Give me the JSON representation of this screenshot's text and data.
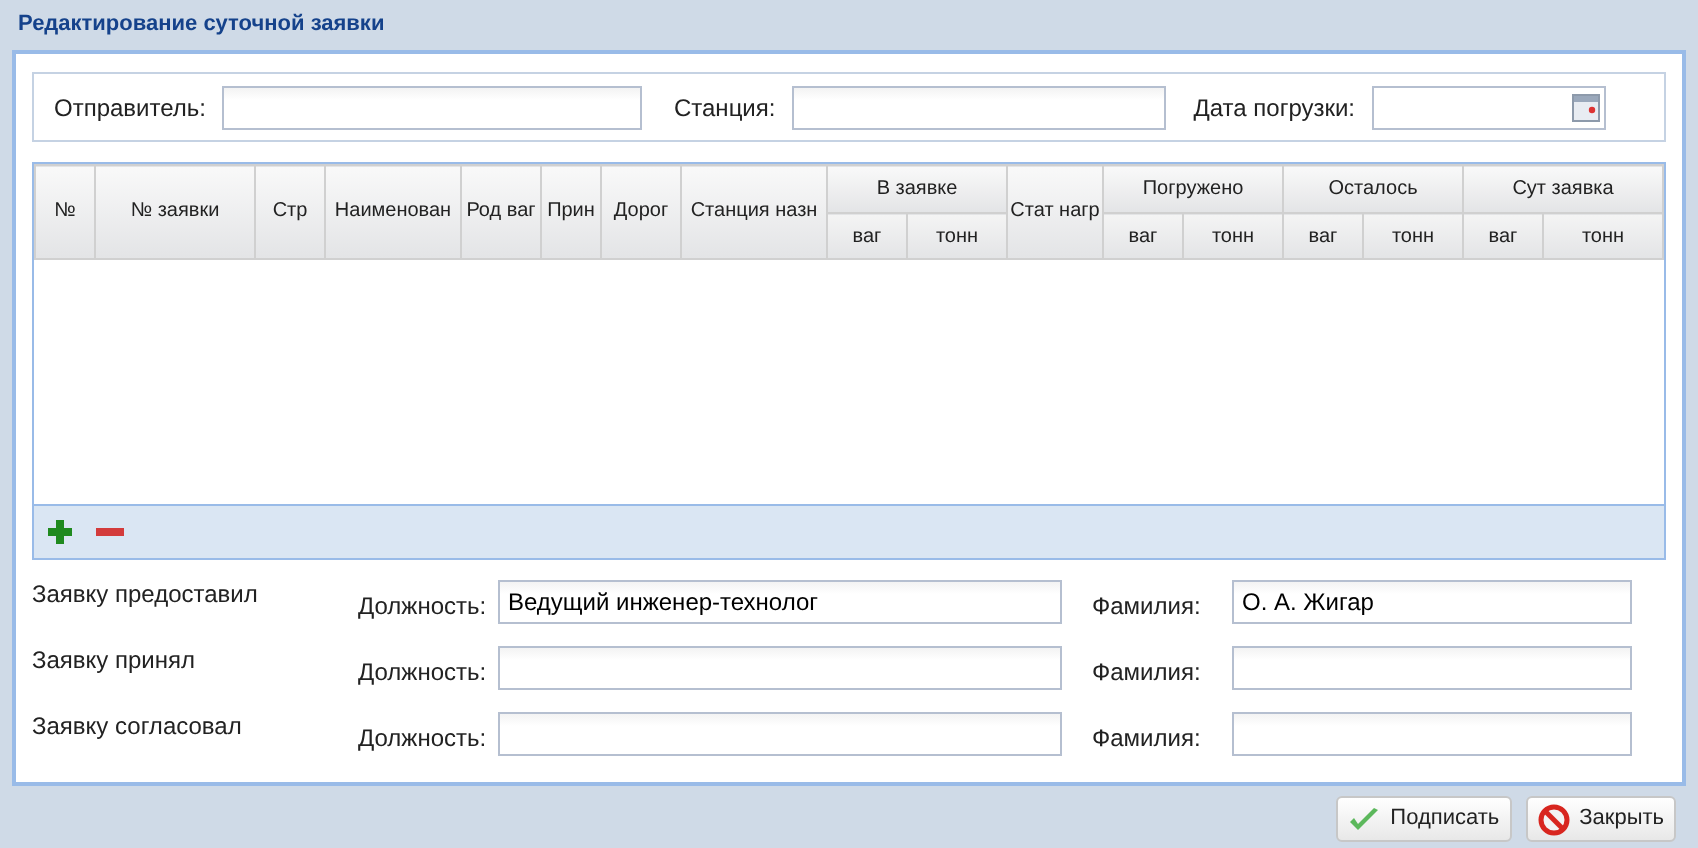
{
  "window": {
    "title": "Редактирование суточной заявки"
  },
  "filters": [
    {
      "label": "Отправитель:",
      "kind": "text"
    },
    {
      "label": "Станция:",
      "kind": "text"
    },
    {
      "label": "Дата погрузки:",
      "kind": "date"
    }
  ],
  "table": {
    "columns": [
      {
        "label": "№"
      },
      {
        "label": "№ заявки"
      },
      {
        "label": "Стр"
      },
      {
        "label": "Наименован"
      },
      {
        "label": "Род ваг"
      },
      {
        "label": "Прин"
      },
      {
        "label": "Дорог"
      },
      {
        "label": "Станция назн"
      },
      {
        "label": "В заявке",
        "children": [
          {
            "label": "ваг"
          },
          {
            "label": "тонн"
          }
        ]
      },
      {
        "label": "Стат нагр"
      },
      {
        "label": "Погружено",
        "children": [
          {
            "label": "ваг"
          },
          {
            "label": "тонн"
          }
        ]
      },
      {
        "label": "Осталось",
        "children": [
          {
            "label": "ваг"
          },
          {
            "label": "тонн"
          }
        ]
      },
      {
        "label": "Сут заявка",
        "children": [
          {
            "label": "ваг"
          },
          {
            "label": "тонн"
          }
        ]
      }
    ]
  },
  "signatures": [
    {
      "label": "Заявку предоставил",
      "position_label": "Должность:",
      "position": "Ведущий инженер-технолог",
      "surname_label": "Фамилия:",
      "surname": "О. А. Жигар"
    },
    {
      "label": "Заявку принял",
      "position_label": "Должность:",
      "surname_label": "Фамилия:"
    },
    {
      "label": "Заявку согласовал",
      "position_label": "Должность:",
      "surname_label": "Фамилия:"
    }
  ],
  "buttons": [
    {
      "label": "Подписать",
      "kind": "sign"
    },
    {
      "label": "Закрыть",
      "kind": "close"
    }
  ]
}
